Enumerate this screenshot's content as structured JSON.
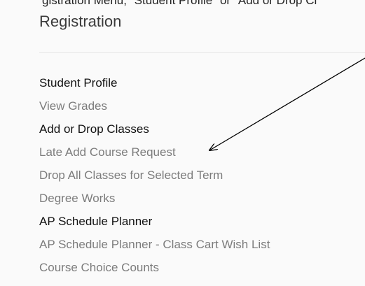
{
  "cutoff_text": "gistration Menu, \"Student Profile\" or \"Add or Drop Cl",
  "page_title": "Registration",
  "menu_items": [
    {
      "label": "Student Profile",
      "kind": "header"
    },
    {
      "label": "View Grades",
      "kind": "link"
    },
    {
      "label": "Add or Drop Classes",
      "kind": "header"
    },
    {
      "label": "Late Add Course Request",
      "kind": "link"
    },
    {
      "label": "Drop All Classes for Selected Term",
      "kind": "link"
    },
    {
      "label": "Degree Works",
      "kind": "link"
    },
    {
      "label": "AP Schedule Planner",
      "kind": "header"
    },
    {
      "label": "AP Schedule Planner - Class Cart Wish List",
      "kind": "link"
    },
    {
      "label": "Course Choice Counts",
      "kind": "link"
    }
  ],
  "colors": {
    "header_text": "#111111",
    "link_text": "#7c7c7c",
    "background": "#fafafa",
    "arrow": "#000000"
  }
}
